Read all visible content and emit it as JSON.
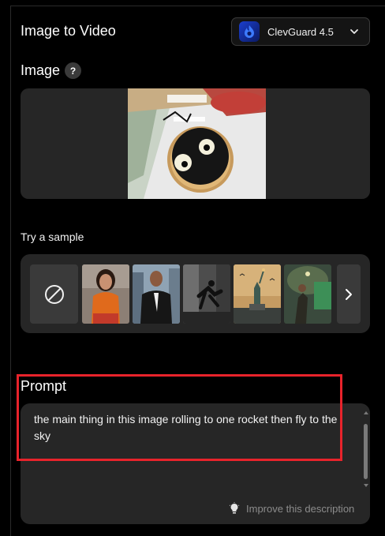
{
  "header": {
    "title": "Image to Video"
  },
  "model_select": {
    "label": "ClevGuard 4.5",
    "logo_icon": "clevguard-flame-logo"
  },
  "image_section": {
    "heading": "Image",
    "help_symbol": "?"
  },
  "samples": {
    "label": "Try a sample",
    "items": [
      {
        "name": "sample-woman-orange-top"
      },
      {
        "name": "sample-man-suit"
      },
      {
        "name": "sample-runner-city"
      },
      {
        "name": "sample-statue-of-liberty"
      },
      {
        "name": "sample-subway-runner"
      }
    ]
  },
  "prompt": {
    "heading": "Prompt",
    "text": "the main thing in this image rolling to one rocket then fly to the sky",
    "improve_label": "Improve this description"
  },
  "colors": {
    "background": "#000000",
    "panel": "#262626",
    "highlight": "#e8232b",
    "accent": "#1b3fcf"
  }
}
